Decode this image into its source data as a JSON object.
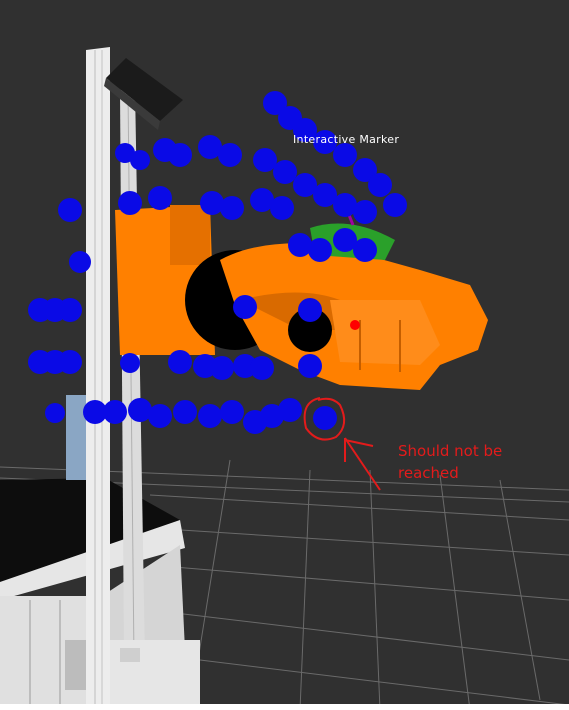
{
  "viewport": {
    "marker_label": "Interactive  Marker",
    "annotation": {
      "line1": "Should not be",
      "line2": "reached"
    },
    "colors": {
      "background": "#303030",
      "grid": "#6a6a6a",
      "robot_arm": "#ff8000",
      "reachable_point": "#0a0ae6",
      "annotation": "#e31b1b",
      "table_top": "#111111",
      "frame": "#e8e8e8"
    }
  }
}
